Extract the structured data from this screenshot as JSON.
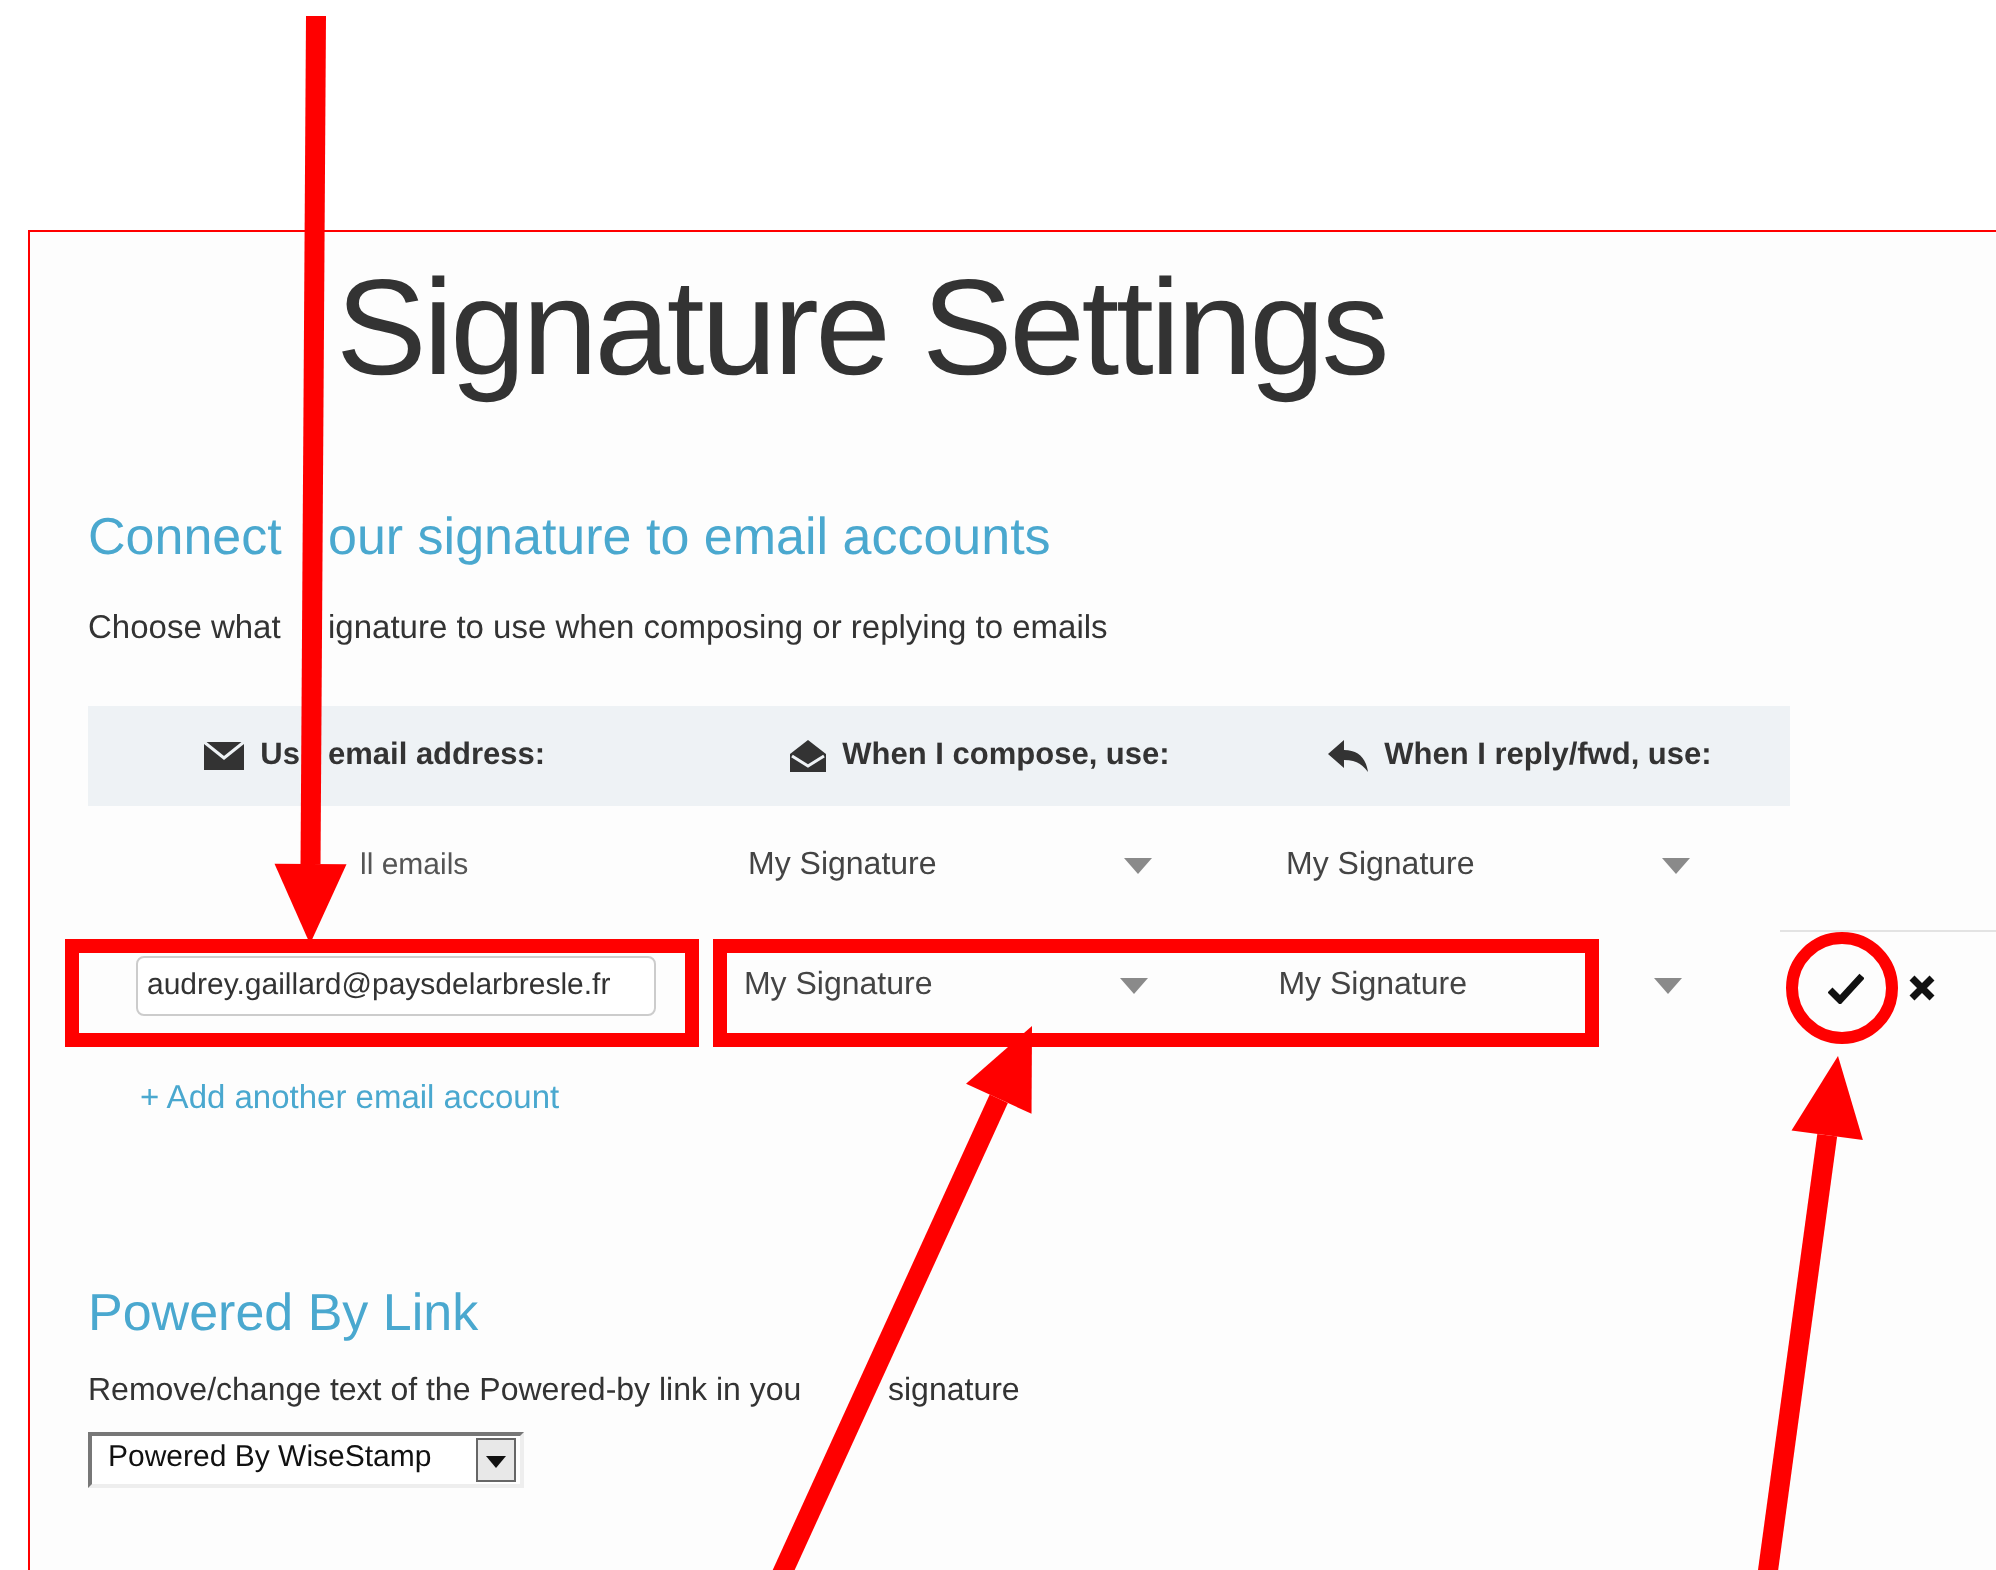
{
  "page": {
    "title": "Signature Settings"
  },
  "connect_section": {
    "heading": [
      "Connect",
      "our signature to email accounts"
    ],
    "description": [
      "Choose what",
      "ignature to use when composing or replying to emails"
    ],
    "columns": [
      [
        "Us",
        "email address:"
      ],
      [
        "When I compose, use:"
      ],
      [
        "When I reply/fwd, use:"
      ]
    ],
    "rows": [
      {
        "kind": "text",
        "email": "ll emails",
        "compose": "My Signature",
        "reply": "My Signature"
      },
      {
        "kind": "editing",
        "email": "audrey.gaillard@paysdelarbresle.fr",
        "compose": "My Signature",
        "reply": "My Signature"
      }
    ],
    "add_link": "+ Add another email account"
  },
  "powered_section": {
    "heading": "Powered By Link",
    "description": [
      "Remove/change text of the Powered-by link in you",
      "signature"
    ],
    "select_value": "Powered By WiseStamp"
  },
  "annotations": [
    {
      "kind": "arrow"
    },
    {
      "kind": "box"
    },
    {
      "kind": "box"
    },
    {
      "kind": "circle"
    },
    {
      "kind": "arrow"
    },
    {
      "kind": "arrow"
    }
  ]
}
